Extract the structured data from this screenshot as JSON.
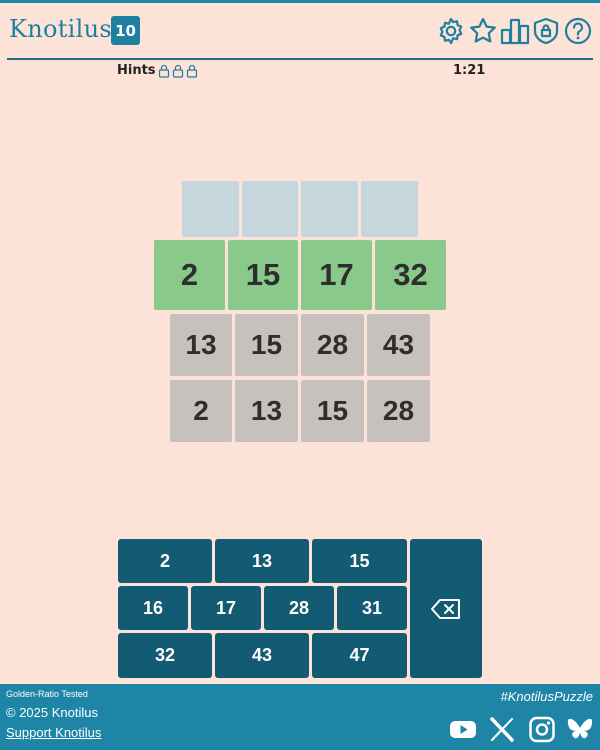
{
  "header": {
    "logo_text": "Knotilus",
    "logo_badge": "10",
    "icons": [
      "gear-icon",
      "star-icon",
      "stats-icon",
      "shield-lock-icon",
      "help-icon"
    ]
  },
  "status": {
    "hints_label": "Hints",
    "hint_locks": 3,
    "timer": "1:21"
  },
  "board": {
    "answer_row": [
      "",
      "",
      "",
      ""
    ],
    "guess_rows": [
      [
        "2",
        "15",
        "17",
        "32"
      ],
      [
        "13",
        "15",
        "28",
        "43"
      ],
      [
        "2",
        "13",
        "15",
        "28"
      ]
    ]
  },
  "keypad": {
    "row1": [
      "2",
      "13",
      "15"
    ],
    "row2": [
      "16",
      "17",
      "28",
      "31"
    ],
    "row3": [
      "32",
      "43",
      "47"
    ],
    "backspace_icon": "backspace-icon"
  },
  "footer": {
    "tested": "Golden-Ratio Tested",
    "copyright": "© 2025 Knotilus",
    "support": "Support Knotilus",
    "hashtag": "#KnotilusPuzzle",
    "social": [
      "youtube-icon",
      "x-icon",
      "instagram-icon",
      "bluesky-icon"
    ]
  },
  "colors": {
    "background": "#fde3d7",
    "brand": "#1f7fa0",
    "key": "#135a73",
    "correct": "#89c98a",
    "guess": "#c7c1bd",
    "empty": "#c5d6dc",
    "footer": "#1e85a7"
  }
}
